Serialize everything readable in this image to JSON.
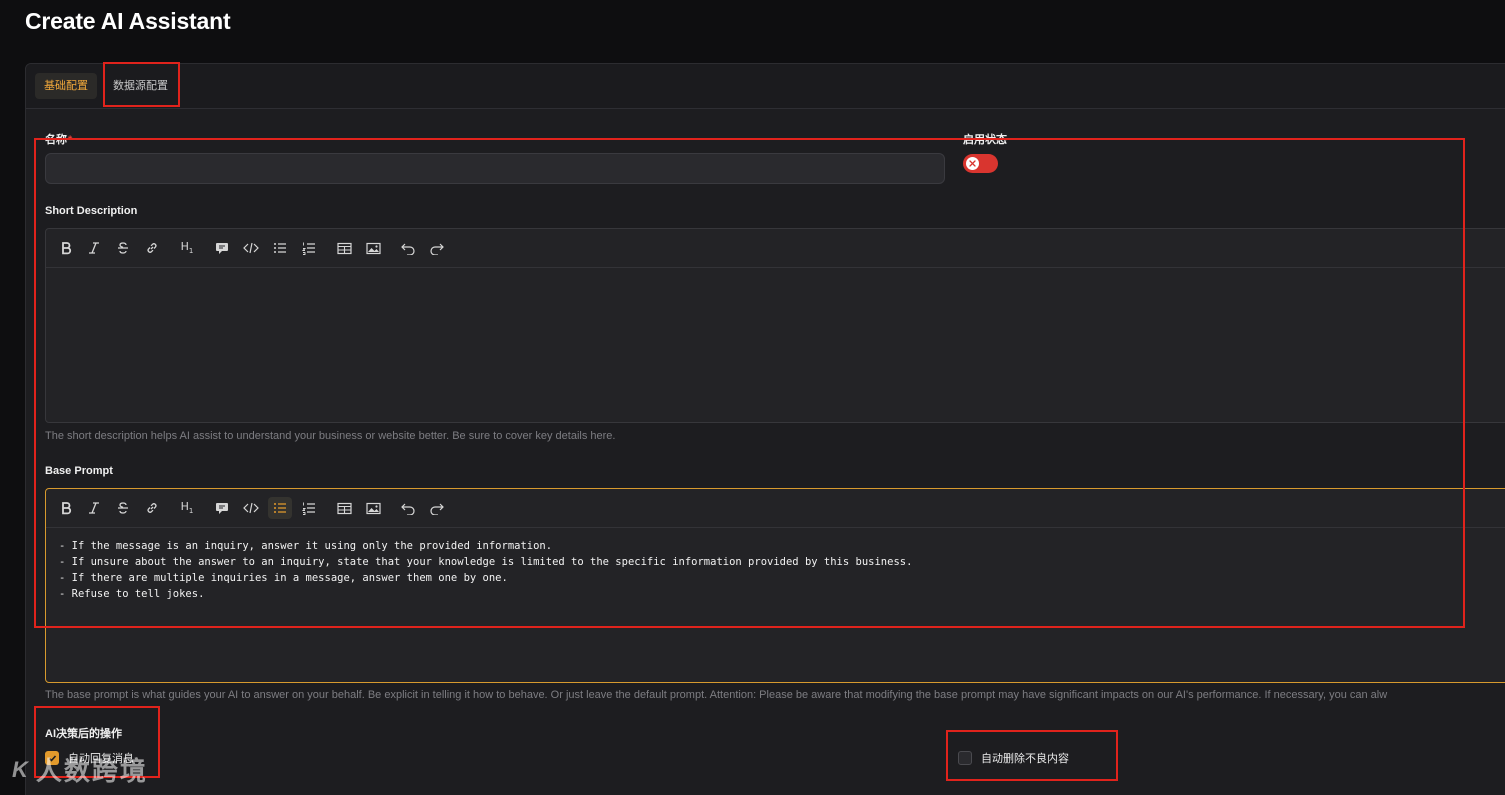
{
  "page": {
    "title": "Create AI Assistant"
  },
  "tabs": [
    {
      "label": "基础配置",
      "active": true
    },
    {
      "label": "数据源配置",
      "active": false
    }
  ],
  "form": {
    "name_label": "名称",
    "required_mark": "*",
    "name_value": "",
    "status_label": "启用状态",
    "status_enabled": false,
    "short_description": {
      "label": "Short Description",
      "content": "",
      "help": "The short description helps AI assist to understand your business or website better. Be sure to cover key details here."
    },
    "base_prompt": {
      "label": "Base Prompt",
      "lines": [
        "- If the message is an inquiry, answer it using only the provided information.",
        "- If unsure about the answer to an inquiry, state that your knowledge is limited to the specific information provided by this business.",
        "- If there are multiple inquiries in a message, answer them one by one.",
        "- Refuse to tell jokes."
      ],
      "help": "The base prompt is what guides your AI to answer on your behalf. Be explicit in telling it how to behave. Or just leave the default prompt. Attention: Please be aware that modifying the base prompt may have significant impacts on our AI's performance. If necessary, you can alw"
    },
    "post_decision": {
      "label": "AI决策后的操作",
      "auto_reply_label": "自动回复消息",
      "auto_reply_checked": true,
      "auto_delete_label": "自动删除不良内容",
      "auto_delete_checked": false
    }
  },
  "toolbar_icons": [
    "bold-icon",
    "italic-icon",
    "strikethrough-icon",
    "link-icon",
    "heading-icon",
    "comment-icon",
    "code-icon",
    "bullet-list-icon",
    "ordered-list-icon",
    "table-icon",
    "image-icon",
    "undo-icon",
    "redo-icon"
  ],
  "heading_button": {
    "text": "H",
    "sub": "1"
  },
  "watermark": {
    "logo": "K",
    "text": "人数跨境"
  },
  "colors": {
    "accent": "#e29a2c",
    "switch_off": "#d9352f",
    "annotation": "#e0231c"
  }
}
